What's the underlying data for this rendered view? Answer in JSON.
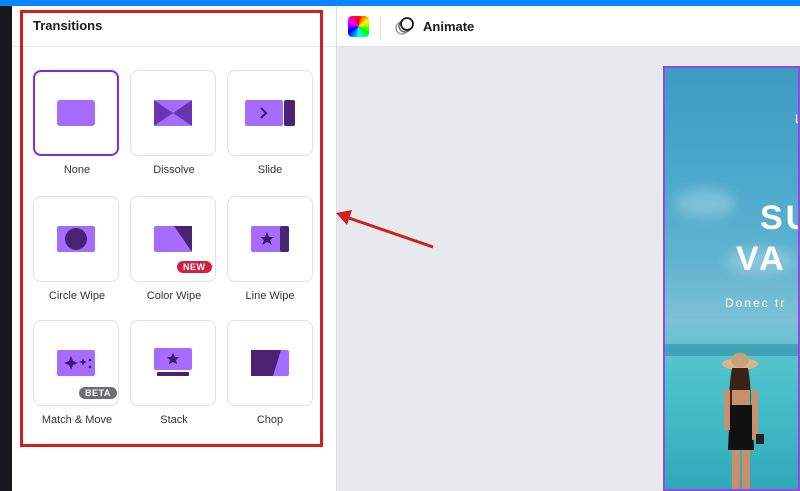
{
  "panel": {
    "title": "Transitions",
    "tiles": [
      {
        "label": "None",
        "selected": true
      },
      {
        "label": "Dissolve"
      },
      {
        "label": "Slide"
      },
      {
        "label": "Circle Wipe"
      },
      {
        "label": "Color Wipe",
        "badge": "NEW"
      },
      {
        "label": "Line Wipe"
      },
      {
        "label": "Match & Move",
        "badge": "BETA"
      },
      {
        "label": "Stack"
      },
      {
        "label": "Chop"
      }
    ]
  },
  "toolbar": {
    "animate_label": "Animate"
  },
  "canvas": {
    "line1": "L",
    "line2": "SU",
    "line3": "VA",
    "line4": "Donec tr"
  },
  "colors": {
    "accent": "#7d2ae8",
    "icon_purple": "#a66bff",
    "icon_dark": "#4a2472",
    "highlight_red": "#d11f1f"
  }
}
